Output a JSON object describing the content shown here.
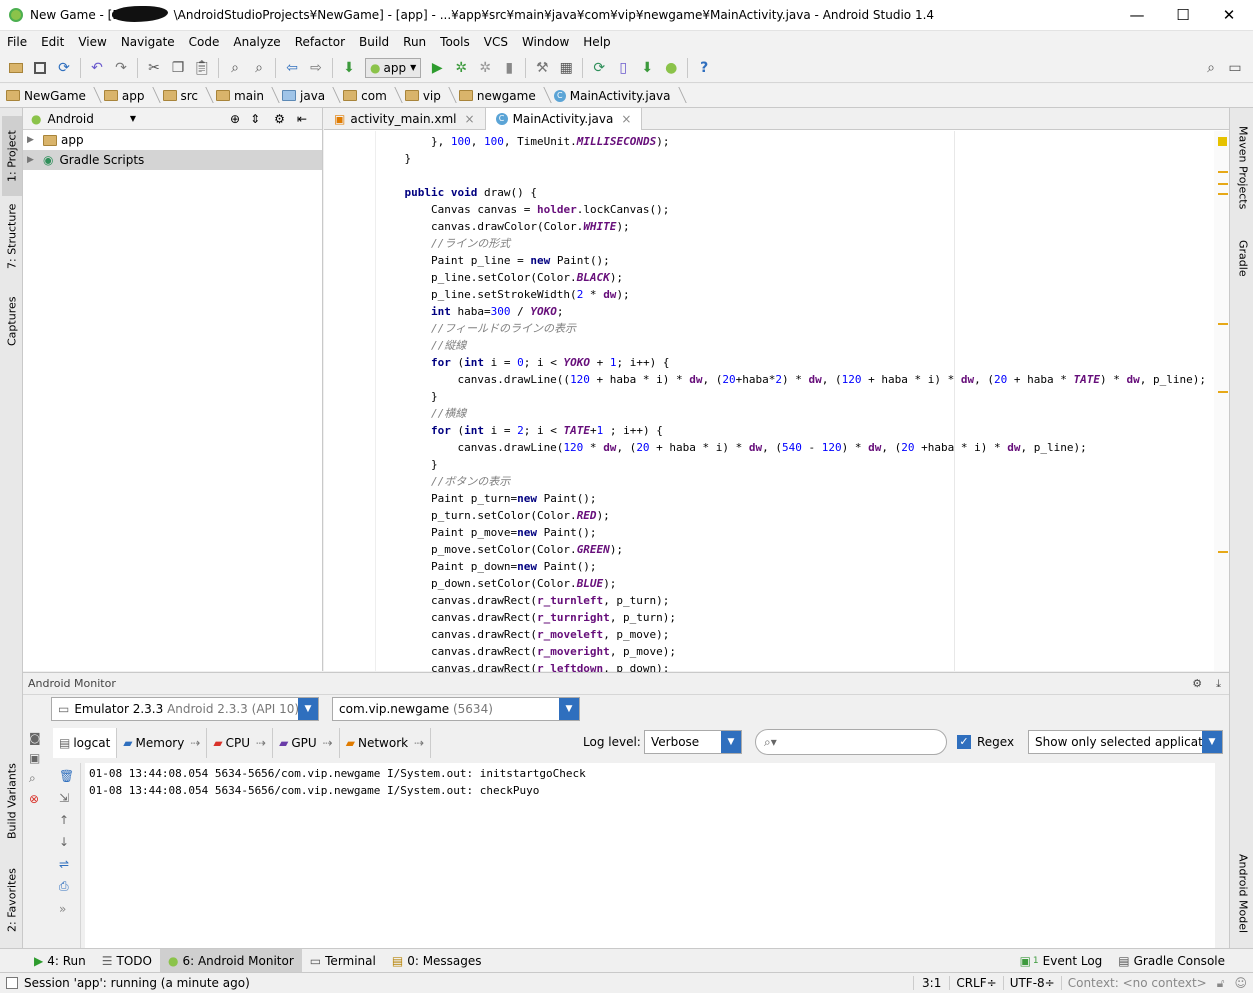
{
  "window": {
    "title_prefix": "New Game - [D:",
    "title_suffix": "\\AndroidStudioProjects¥NewGame] - [app] - ...¥app¥src¥main¥java¥com¥vip¥newgame¥MainActivity.java - Android Studio 1.4",
    "minimize": "—",
    "maximize": "☐",
    "close": "✕"
  },
  "menu": [
    "File",
    "Edit",
    "View",
    "Navigate",
    "Code",
    "Analyze",
    "Refactor",
    "Build",
    "Run",
    "Tools",
    "VCS",
    "Window",
    "Help"
  ],
  "toolbar": {
    "run_config": "app"
  },
  "breadcrumbs": [
    "NewGame",
    "app",
    "src",
    "main",
    "java",
    "com",
    "vip",
    "newgame",
    "MainActivity.java"
  ],
  "left_tools": {
    "project": "1: Project",
    "structure": "7: Structure",
    "captures": "Captures",
    "build_variants": "Build Variants",
    "favorites": "2: Favorites"
  },
  "right_tools": {
    "maven": "Maven Projects",
    "gradle": "Gradle",
    "android_model": "Android Model"
  },
  "project": {
    "view_mode": "Android",
    "items": [
      "app",
      "Gradle Scripts"
    ]
  },
  "editor": {
    "tabs": [
      "activity_main.xml",
      "MainActivity.java"
    ],
    "active_tab": "MainActivity.java"
  },
  "monitor": {
    "title": "Android Monitor",
    "device": "Emulator 2.3.3",
    "device_detail": "Android 2.3.3 (API 10)",
    "process": "com.vip.newgame",
    "process_pid": "(5634)",
    "tabs": [
      "logcat",
      "Memory",
      "CPU",
      "GPU",
      "Network"
    ],
    "log_level_label": "Log level:",
    "log_level": "Verbose",
    "search_placeholder": "",
    "regex_label": "Regex",
    "filter": "Show only selected application",
    "lines": [
      "01-08 13:44:08.054 5634-5656/com.vip.newgame I/System.out: initstartgoCheck",
      "01-08 13:44:08.054 5634-5656/com.vip.newgame I/System.out: checkPuyo"
    ]
  },
  "bottom_tabs": {
    "run": "4: Run",
    "todo": "TODO",
    "monitor": "6: Android Monitor",
    "terminal": "Terminal",
    "messages": "0: Messages",
    "event_log": "Event Log",
    "gradle_console": "Gradle Console",
    "event_count": "1"
  },
  "status": {
    "session": "Session 'app': running (a minute ago)",
    "position": "3:1",
    "line_sep": "CRLF÷",
    "encoding": "UTF-8÷",
    "context": "Context: <no context>"
  }
}
